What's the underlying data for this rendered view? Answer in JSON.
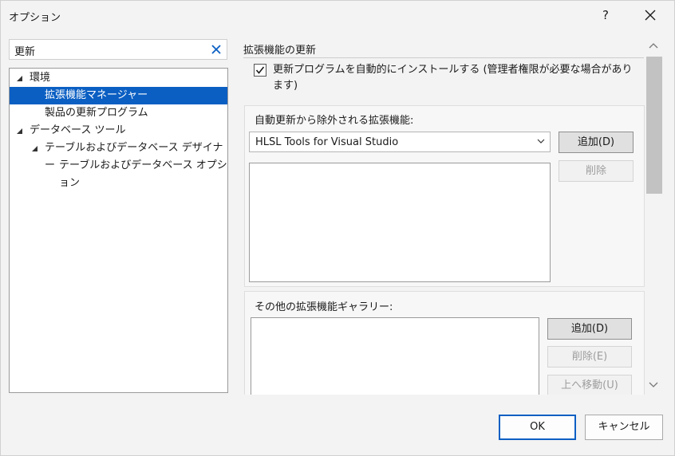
{
  "window": {
    "title": "オプション",
    "help_label": "?"
  },
  "search": {
    "value": "更新"
  },
  "tree": {
    "items": [
      {
        "label": "環境"
      },
      {
        "label": "拡張機能マネージャー"
      },
      {
        "label": "製品の更新プログラム"
      },
      {
        "label": "データベース ツール"
      },
      {
        "label": "テーブルおよびデータベース デザイナー"
      },
      {
        "label": "テーブルおよびデータベース オプション"
      }
    ]
  },
  "page": {
    "section_title": "拡張機能の更新",
    "auto_update_checkbox": {
      "checked": true,
      "label": "更新プログラムを自動的にインストールする (管理者権限が必要な場合があります)"
    },
    "excluded_group": {
      "label": "自動更新から除外される拡張機能:",
      "combo_value": "HLSL Tools for Visual Studio",
      "add_label": "追加(D)",
      "delete_label": "削除"
    },
    "gallery_group": {
      "label": "その他の拡張機能ギャラリー:",
      "add_label": "追加(D)",
      "delete_label": "削除(E)",
      "move_up_label": "上へ移動(U)"
    }
  },
  "footer": {
    "ok_label": "OK",
    "cancel_label": "キャンセル"
  },
  "colors": {
    "selection": "#0b5fc3",
    "accent": "#0b5fc3"
  }
}
